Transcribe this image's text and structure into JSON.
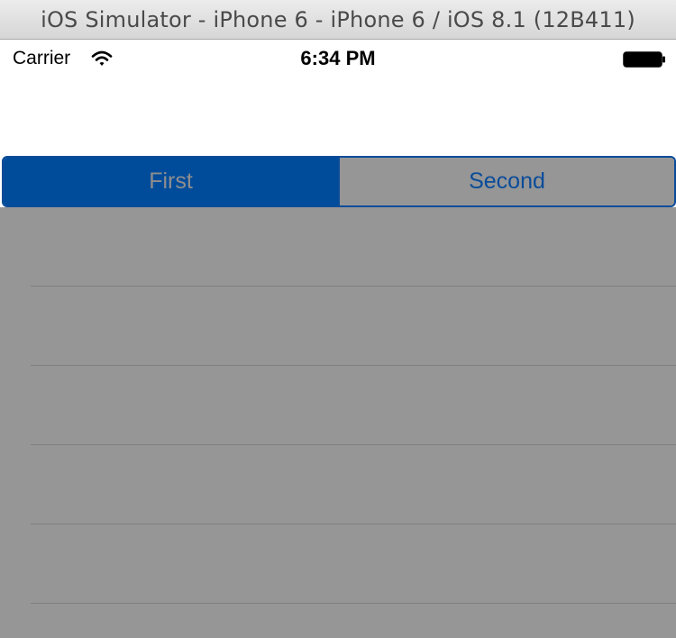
{
  "window": {
    "title": "iOS Simulator - iPhone 6 - iPhone 6 / iOS 8.1 (12B411)"
  },
  "status_bar": {
    "carrier": "Carrier",
    "time": "6:34 PM",
    "wifi_icon": "wifi-icon",
    "battery_icon": "battery-icon"
  },
  "segmented_control": {
    "segments": [
      {
        "label": "First",
        "selected": true
      },
      {
        "label": "Second",
        "selected": false
      }
    ],
    "tint_color": "#0a4c99"
  },
  "table": {
    "background_color": "#969696",
    "row_count": 5
  }
}
